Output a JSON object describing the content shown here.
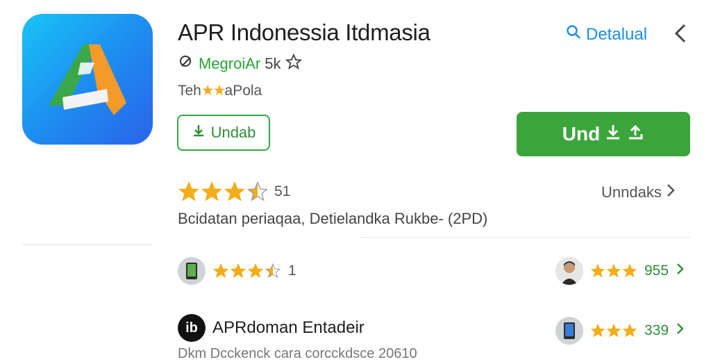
{
  "app": {
    "title": "APR Indonessia Itdmasia",
    "developer": "MegroiAr",
    "developer_count": "5k",
    "tagline_prefix": "Teh",
    "tagline_stars": "★★",
    "tagline_suffix": "aPola",
    "install_outline_label": "Undab",
    "install_primary_label": "Und",
    "colors": {
      "accent_green": "#3ba53b",
      "link_blue": "#1b8ee4",
      "star": "#f2ad1a"
    }
  },
  "header": {
    "detail_label": "Detalual"
  },
  "rating": {
    "stars": 3.5,
    "count": "51",
    "reviews_label": "Unndaks"
  },
  "description": "Bcidatan periaqaa, Detielandka Rukbe- (2PD)",
  "reviews": [
    {
      "stars": 3.5,
      "count": "1"
    },
    {
      "stars": 3,
      "count": "955"
    },
    {
      "stars": 3,
      "count": "339"
    }
  ],
  "app2": {
    "logo_text": "ib",
    "name": "APRdoman Entadeir",
    "desc": "Dkm Dcckenck cara corcckdsce 20610"
  }
}
